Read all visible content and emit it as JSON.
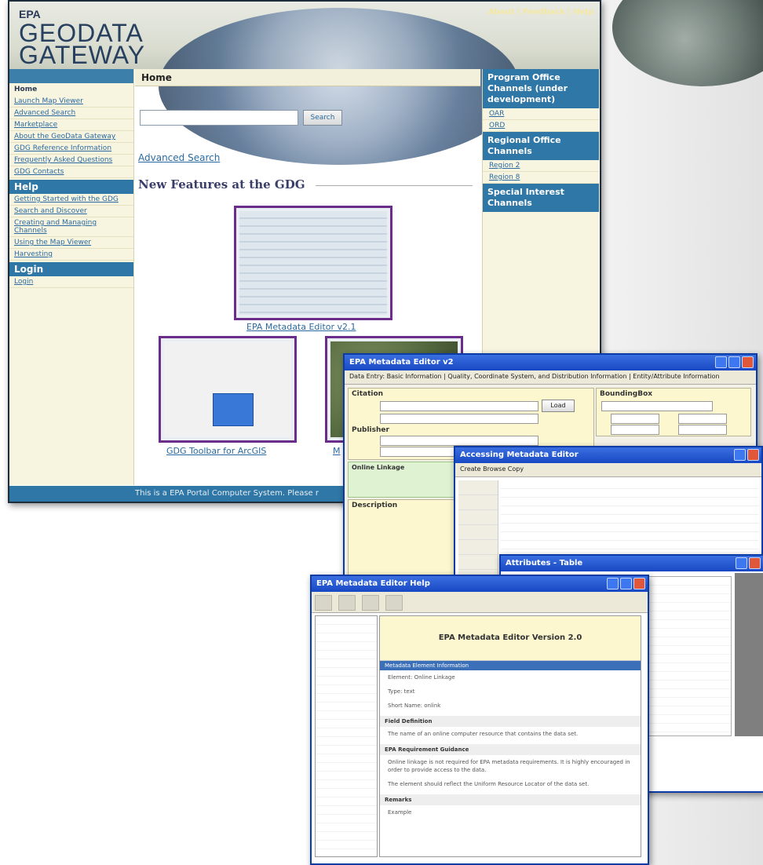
{
  "gdg": {
    "agency": "EPA",
    "title_line1": "GEODATA",
    "title_line2": "GATEWAY",
    "top_links": [
      "About",
      "Feedback",
      "Help"
    ],
    "left_nav": {
      "home": "Home",
      "items": [
        "Launch Map Viewer",
        "Advanced Search",
        "Marketplace",
        "About the GeoData Gateway",
        "GDG Reference Information",
        "Frequently Asked Questions",
        "GDG Contacts"
      ],
      "help_header": "Help",
      "help_items": [
        "Getting Started with the GDG",
        "Search and Discover",
        "Creating and Managing Channels",
        "Using the Map Viewer",
        "Harvesting"
      ],
      "login_header": "Login",
      "login_items": [
        "Login"
      ]
    },
    "main": {
      "page_title": "Home",
      "search_button": "Search",
      "advanced_search": "Advanced Search",
      "new_features": "New Features at the GDG",
      "captions": [
        "EPA Metadata Editor v2.1",
        "GDG Toolbar for ArcGIS",
        "M"
      ]
    },
    "right": {
      "program_header": "Program Office Channels (under development)",
      "program_items": [
        "OAR",
        "ORD"
      ],
      "regional_header": "Regional Office Channels",
      "regional_items": [
        "Region 2",
        "Region 8"
      ],
      "special_header": "Special Interest Channels"
    },
    "footer": "This is a EPA Portal Computer System. Please r"
  },
  "meta_editor": {
    "title": "EPA Metadata Editor v2",
    "tabs": "Data Entry: Basic Information  |  Quality, Coordinate System, and Distribution Information  |  Entity/Attribute Information",
    "citation": "Citation",
    "publisher": "Publisher",
    "online_linkage": "Online Linkage",
    "description": "Description",
    "bounding": "BoundingBox",
    "load_button": "Load"
  },
  "access_window": {
    "title": "Accessing Metadata Editor",
    "toolbar": "Create  Browse  Copy"
  },
  "attr_window": {
    "title": "Attributes - Table"
  },
  "help_window": {
    "title": "EPA Metadata Editor Help",
    "doc_title": "EPA Metadata Editor Version 2.0",
    "bar": "Metadata Element Information",
    "para1": "Element: Online Linkage",
    "para2": "Type: text",
    "para3": "Short Name: onlink",
    "sub1": "Field Definition",
    "para4": "The name of an online computer resource that contains the data set.",
    "sub2": "EPA Requirement Guidance",
    "para5": "Online linkage is not required for EPA metadata requirements. It is highly encouraged in order to provide access to the data.",
    "para6": "The element should reflect the Uniform Resource Locator of the data set.",
    "sub3": "Remarks",
    "para7": "Example"
  },
  "colors": {
    "nav_blue": "#2f77a6",
    "link": "#2a6aa0",
    "beige": "#f7f4df",
    "purple_frame": "#6a2d8a"
  }
}
